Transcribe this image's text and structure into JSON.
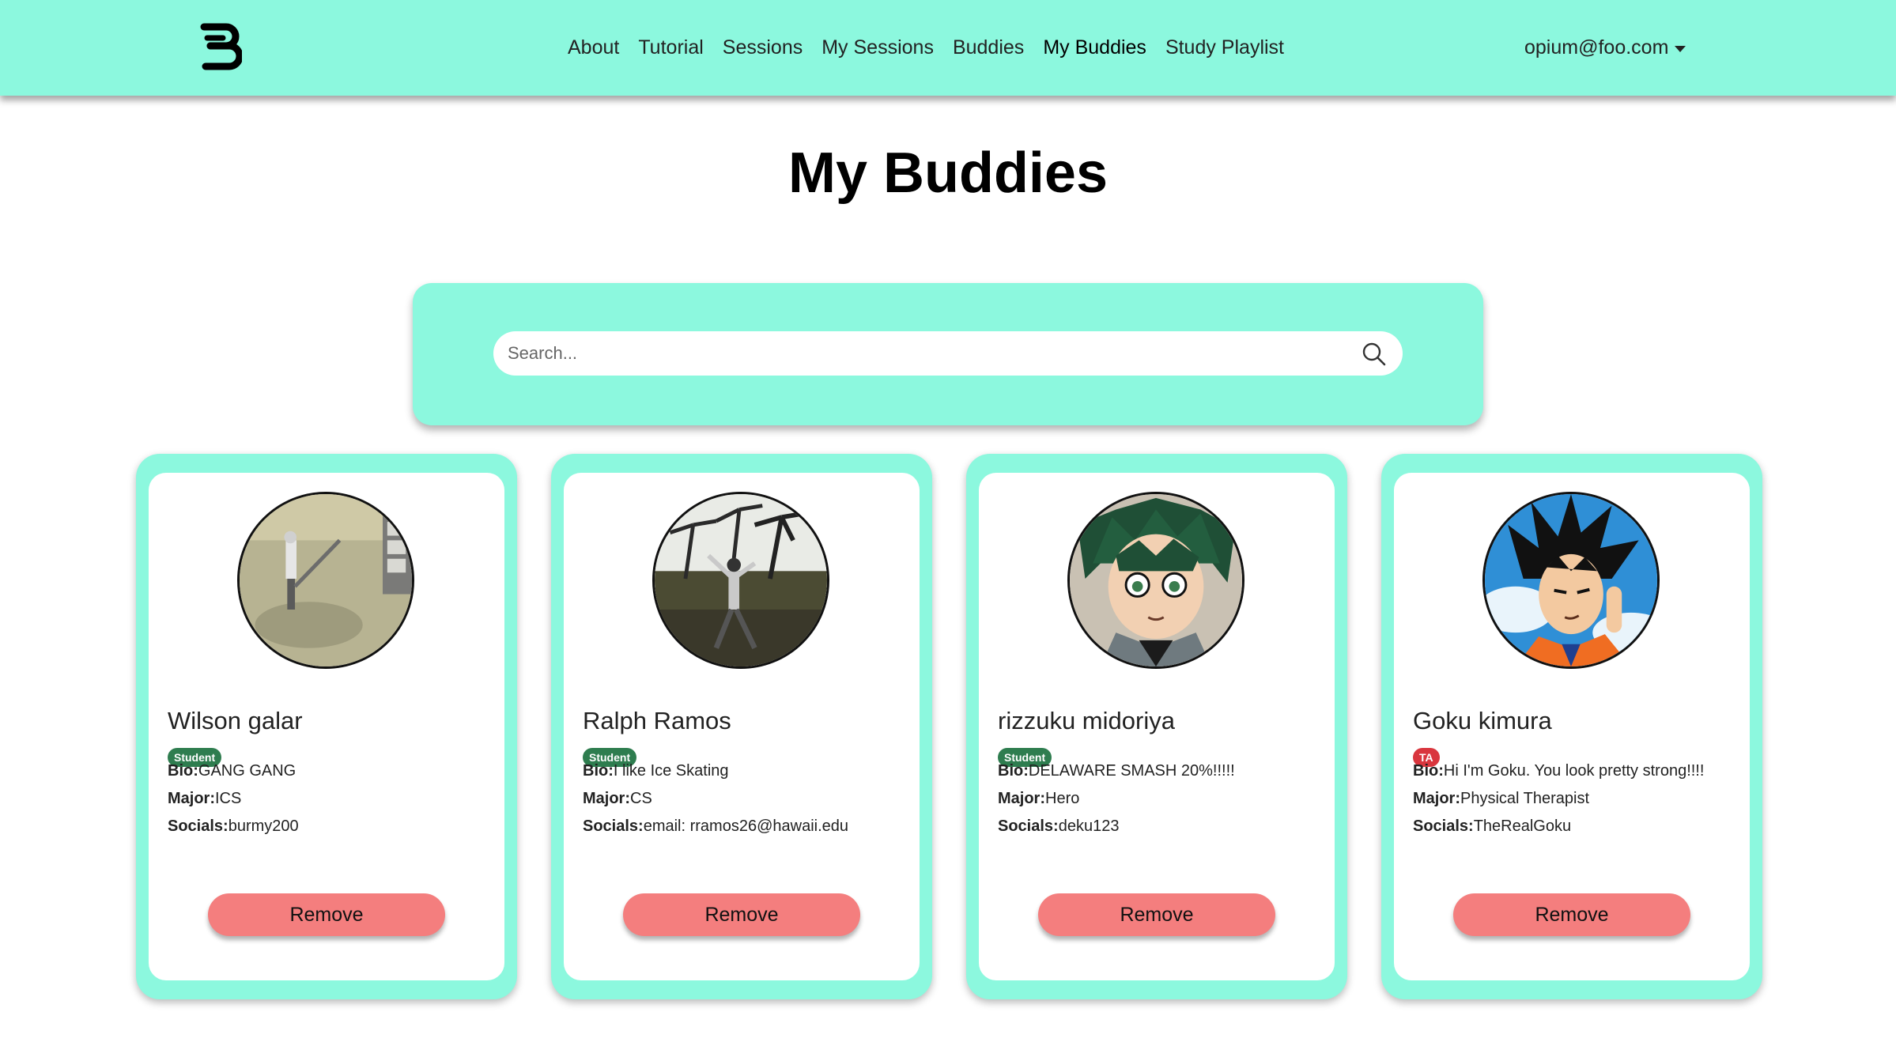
{
  "nav": {
    "links": [
      "About",
      "Tutorial",
      "Sessions",
      "My Sessions",
      "Buddies",
      "My Buddies",
      "Study Playlist"
    ],
    "active": "My Buddies",
    "user_email": "opium@foo.com"
  },
  "page": {
    "title": "My Buddies"
  },
  "search": {
    "placeholder": "Search..."
  },
  "labels": {
    "bio": "Bio:",
    "major": "Major:",
    "socials": "Socials:",
    "remove": "Remove"
  },
  "colors": {
    "accent": "#8cf8de",
    "remove_button": "#f47e7e",
    "student_badge": "#2e7d4f",
    "ta_badge": "#d9363e"
  },
  "buddies": [
    {
      "name": "Wilson galar",
      "role": "Student",
      "bio": "GANG GANG",
      "major": "ICS",
      "socials": "burmy200"
    },
    {
      "name": "Ralph Ramos",
      "role": "Student",
      "bio": "I like Ice Skating",
      "major": "CS",
      "socials": "email: rramos26@hawaii.edu"
    },
    {
      "name": "rizzuku midoriya",
      "role": "Student",
      "bio": "DELAWARE SMASH 20%!!!!!",
      "major": "Hero",
      "socials": "deku123"
    },
    {
      "name": "Goku kimura",
      "role": "TA",
      "bio": "Hi I'm Goku. You look pretty strong!!!!",
      "major": "Physical Therapist",
      "socials": "TheRealGoku"
    }
  ]
}
